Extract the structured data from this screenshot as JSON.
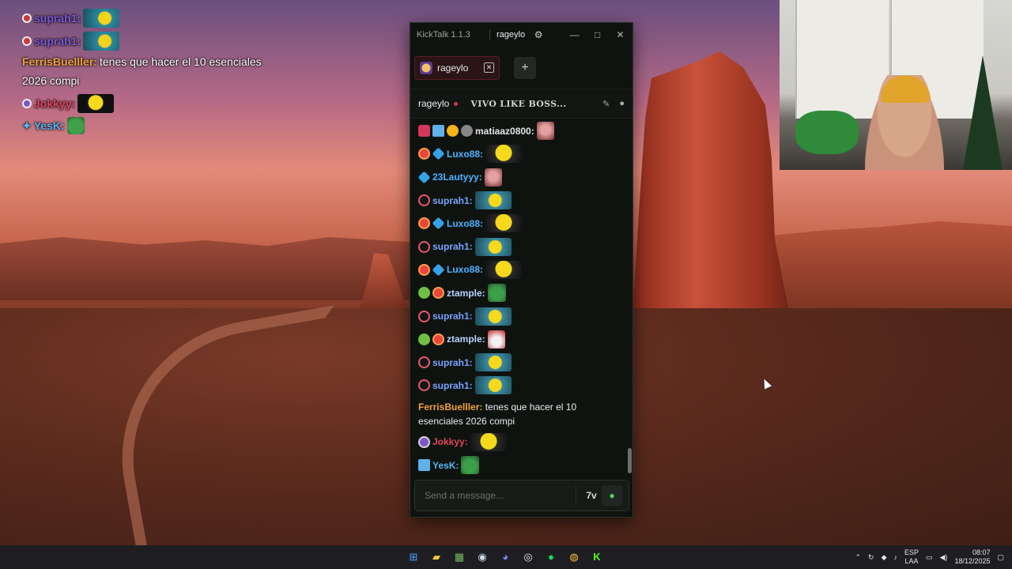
{
  "overlay_chat": [
    {
      "user": "suprah1:",
      "color": "#7d5ad6"
    },
    {
      "user": "suprah1:",
      "color": "#7d5ad6"
    },
    {
      "user": "FerrisBuelller:",
      "color": "#f0a23c",
      "text_line1": "tenes que hacer el 10 esenciales",
      "text_line2": "2026 compi"
    },
    {
      "user": "Jokkyy:",
      "color": "#e0445c"
    },
    {
      "user": "YesK:",
      "color": "#5ab4f0"
    }
  ],
  "window": {
    "app_title": "KickTalk 1.1.3",
    "user_tab": "rageylo",
    "gear_icon": "gear-icon",
    "min": "—",
    "max": "□",
    "close": "✕"
  },
  "tabs": {
    "channel_label": "rageylo",
    "close_symbol": "✕",
    "add_symbol": "+"
  },
  "channel_header": {
    "name": "rageylo",
    "stream_title": "VIVO LIKE BOSS..."
  },
  "messages": [
    {
      "user": "matiaaz0800:",
      "color": "#e6e6e6"
    },
    {
      "user": "Luxo88:",
      "color": "#4fb2ff"
    },
    {
      "user": "23Lautyyy:",
      "color": "#4fb2ff"
    },
    {
      "user": "suprah1:",
      "color": "#7aa4ff"
    },
    {
      "user": "Luxo88:",
      "color": "#4fb2ff"
    },
    {
      "user": "suprah1:",
      "color": "#7aa4ff"
    },
    {
      "user": "Luxo88:",
      "color": "#4fb2ff"
    },
    {
      "user": "ztample:",
      "color": "#b9d2ff"
    },
    {
      "user": "suprah1:",
      "color": "#7aa4ff"
    },
    {
      "user": "ztample:",
      "color": "#b9d2ff"
    },
    {
      "user": "suprah1:",
      "color": "#7aa4ff"
    },
    {
      "user": "suprah1:",
      "color": "#7aa4ff"
    },
    {
      "user": "FerrisBuelller:",
      "color": "#f0a23c",
      "text": "tenes que hacer el 10 esenciales 2026 compi"
    },
    {
      "user": "Jokkyy:",
      "color": "#e0445c"
    },
    {
      "user": "YesK:",
      "color": "#5ab4f0"
    }
  ],
  "composer": {
    "placeholder": "Send a message...",
    "seventv_label": "7v",
    "kick_emote_icon": "kick-emote-icon"
  },
  "taskbar": {
    "lang": "ESP",
    "layout": "LAA",
    "time": "08:07",
    "date": "18/12/2025"
  }
}
